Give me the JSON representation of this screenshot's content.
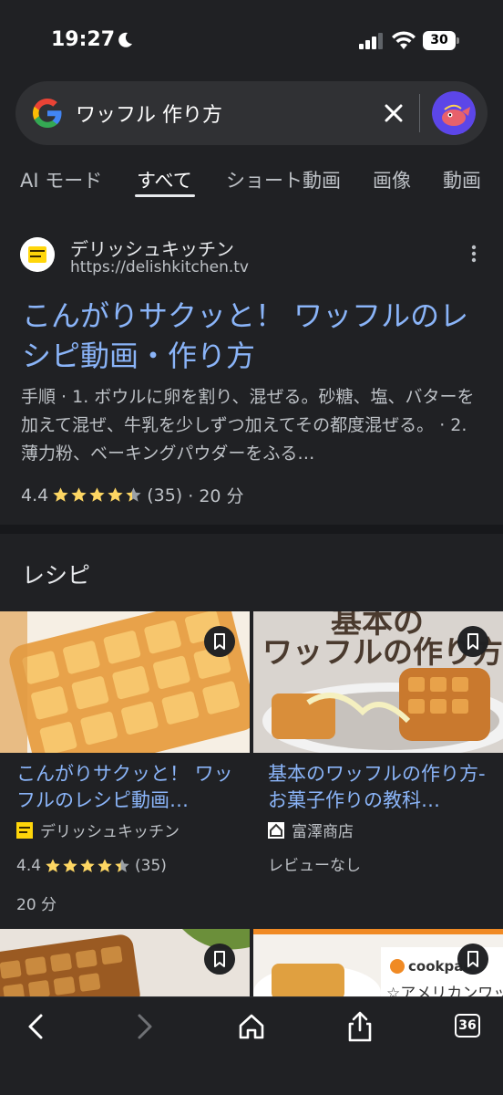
{
  "status_bar": {
    "time": "19:27",
    "battery": "30"
  },
  "search": {
    "query": "ワッフル 作り方"
  },
  "tabs": [
    {
      "label": "AI モード"
    },
    {
      "label": "すべて"
    },
    {
      "label": "ショート動画"
    },
    {
      "label": "画像"
    },
    {
      "label": "動画"
    }
  ],
  "result": {
    "site_name": "デリッシュキッチン",
    "site_url": "https://delishkitchen.tv",
    "title": "こんがりサクッと！ ワッフルのレシピ動画・作り方",
    "snippet": "手順 · 1. ボウルに卵を割り、混ぜる。砂糖、塩、バターを加えて混ぜ、牛乳を少しずつ加えてその都度混ぜる。 · 2. 薄力粉、ベーキングパウダーをふる…",
    "rating": "4.4",
    "rating_value": 4.4,
    "review_count": "(35)",
    "time": "· 20 分"
  },
  "recipes": {
    "heading": "レシピ",
    "cards": [
      {
        "title": "こんがりサクッと！ ワッフルのレシピ動画…",
        "source": "デリッシュキッチン",
        "rating": "4.4",
        "rating_value": 4.4,
        "review_count": "(35)",
        "time": "20 分"
      },
      {
        "title": "基本のワッフルの作り方-お菓子作りの教科…",
        "source": "富澤商店",
        "no_review": "レビューなし",
        "image_text": "ワッフルの作り方",
        "image_text_top": "基本の"
      }
    ],
    "partial_cards": [
      {
        "image_text_brand": "cookpad",
        "image_text": "☆アメリカンワッ"
      }
    ]
  },
  "bottom_bar": {
    "tabs_count": "36"
  },
  "colors": {
    "link": "#8ab4f8",
    "background": "#202124",
    "star": "#fdd663"
  },
  "icons": [
    "google-logo-icon",
    "clear-icon",
    "more-icon",
    "bookmark-icon",
    "back-icon",
    "forward-icon",
    "home-icon",
    "share-icon",
    "tabs-icon"
  ]
}
